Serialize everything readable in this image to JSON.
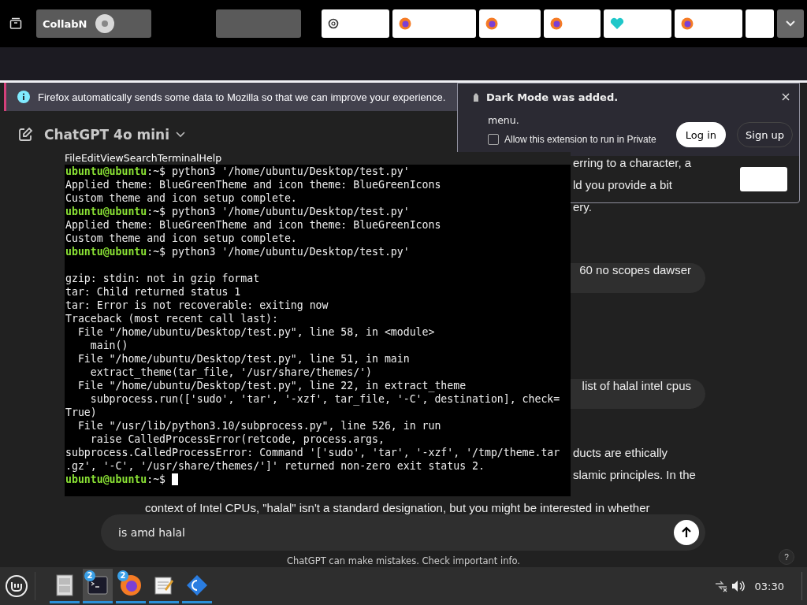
{
  "tabs": [
    {
      "kind": "grey",
      "label": "CollabN"
    },
    {
      "kind": "grey"
    },
    {
      "kind": "white"
    },
    {
      "kind": "white"
    },
    {
      "kind": "white"
    },
    {
      "kind": "white"
    },
    {
      "kind": "white"
    },
    {
      "kind": "white"
    },
    {
      "kind": "white"
    }
  ],
  "notification": {
    "text": "Firefox automatically sends some data to Mozilla so that we can improve your experience."
  },
  "addon_popup": {
    "title": "Dark Mode was added.",
    "text": "menu.",
    "checkbox": {
      "label": "Allow this extension to run in Private",
      "checked": false
    }
  },
  "chat": {
    "model": "ChatGPT 4o mini",
    "login": "Log in",
    "signup": "Sign up",
    "reply_1": [
      "erring to a character, a",
      "ld you provide a bit",
      "ery."
    ],
    "bubbles": [
      "60 no scopes dawser",
      "list of halal intel cpus"
    ],
    "reply_2": [
      "ducts are ethically",
      "slamic principles. In the",
      "context of Intel CPUs, \"halal\" isn't a standard designation, but you might be interested in whether"
    ],
    "input": {
      "value": "is amd halal"
    },
    "footer": "ChatGPT can make mistakes. Check important info.",
    "help": "?"
  },
  "terminal": {
    "menu": [
      "File",
      "Edit",
      "View",
      "Search",
      "Terminal",
      "Help"
    ],
    "lines": [
      {
        "kind": "prompt",
        "user": "ubuntu@ubuntu",
        "rest": ":~$ python3 '/home/ubuntu/Desktop/test.py'"
      },
      {
        "kind": "output",
        "text": "Applied theme: BlueGreenTheme and icon theme: BlueGreenIcons"
      },
      {
        "kind": "output",
        "text": "Custom theme and icon setup complete."
      },
      {
        "kind": "prompt",
        "user": "ubuntu@ubuntu",
        "rest": ":~$ python3 '/home/ubuntu/Desktop/test.py'"
      },
      {
        "kind": "output",
        "text": "Applied theme: BlueGreenTheme and icon theme: BlueGreenIcons"
      },
      {
        "kind": "output",
        "text": "Custom theme and icon setup complete."
      },
      {
        "kind": "prompt",
        "user": "ubuntu@ubuntu",
        "rest": ":~$ python3 '/home/ubuntu/Desktop/test.py'"
      },
      {
        "kind": "blank"
      },
      {
        "kind": "output",
        "text": "gzip: stdin: not in gzip format"
      },
      {
        "kind": "output",
        "text": "tar: Child returned status 1"
      },
      {
        "kind": "output",
        "text": "tar: Error is not recoverable: exiting now"
      },
      {
        "kind": "output",
        "text": "Traceback (most recent call last):"
      },
      {
        "kind": "output",
        "text": "  File \"/home/ubuntu/Desktop/test.py\", line 58, in <module>"
      },
      {
        "kind": "output",
        "text": "    main()"
      },
      {
        "kind": "output",
        "text": "  File \"/home/ubuntu/Desktop/test.py\", line 51, in main"
      },
      {
        "kind": "output",
        "text": "    extract_theme(tar_file, '/usr/share/themes/')"
      },
      {
        "kind": "output",
        "text": "  File \"/home/ubuntu/Desktop/test.py\", line 22, in extract_theme"
      },
      {
        "kind": "output",
        "text": "    subprocess.run(['sudo', 'tar', '-xzf', tar_file, '-C', destination], check="
      },
      {
        "kind": "output",
        "text": "True)"
      },
      {
        "kind": "output",
        "text": "  File \"/usr/lib/python3.10/subprocess.py\", line 526, in run"
      },
      {
        "kind": "output",
        "text": "    raise CalledProcessError(retcode, process.args,"
      },
      {
        "kind": "output",
        "text": "subprocess.CalledProcessError: Command '['sudo', 'tar', '-xzf', '/tmp/theme.tar"
      },
      {
        "kind": "output",
        "text": ".gz', '-C', '/usr/share/themes/']' returned non-zero exit status 2."
      },
      {
        "kind": "prompt",
        "user": "ubuntu@ubuntu",
        "rest": ":~$ ",
        "cursor": true
      }
    ]
  },
  "taskbar": {
    "apps": [
      {
        "active": false
      },
      {
        "badge": "2",
        "active": true
      },
      {
        "badge": "2",
        "active": false
      },
      {
        "active": false
      },
      {
        "active": false
      }
    ],
    "clock": "03:30"
  }
}
